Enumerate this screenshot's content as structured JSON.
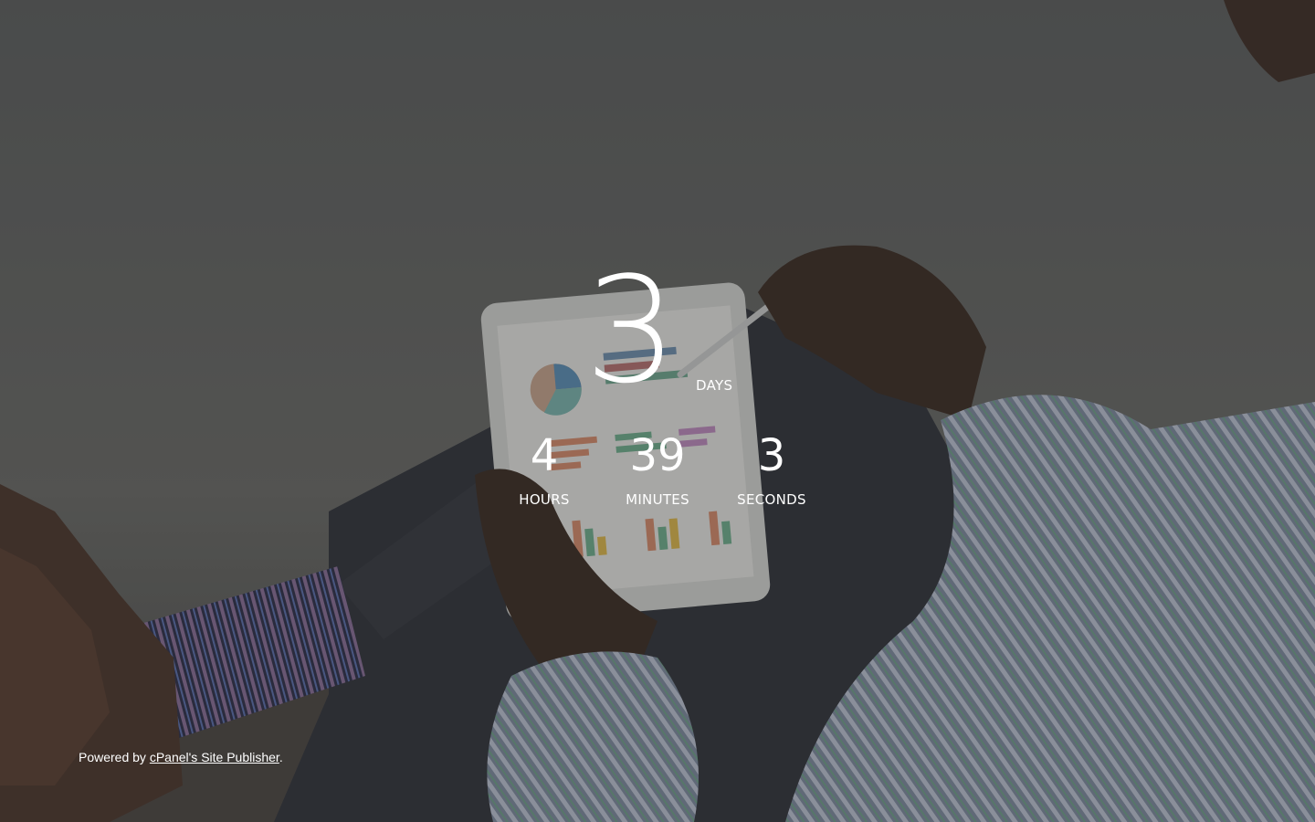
{
  "countdown": {
    "days": {
      "value": "3",
      "label": "DAYS"
    },
    "hours": {
      "value": "4",
      "label": "HOURS"
    },
    "minutes": {
      "value": "39",
      "label": "MINUTES"
    },
    "seconds": {
      "value": "3",
      "label": "SECONDS"
    }
  },
  "footer": {
    "prefix": "Powered by ",
    "link_text": "cPanel's Site Publisher",
    "suffix": "."
  },
  "background": {
    "image": "man-holding-tablet-with-charts-photo",
    "overlay_color": "#2a2c2e"
  }
}
